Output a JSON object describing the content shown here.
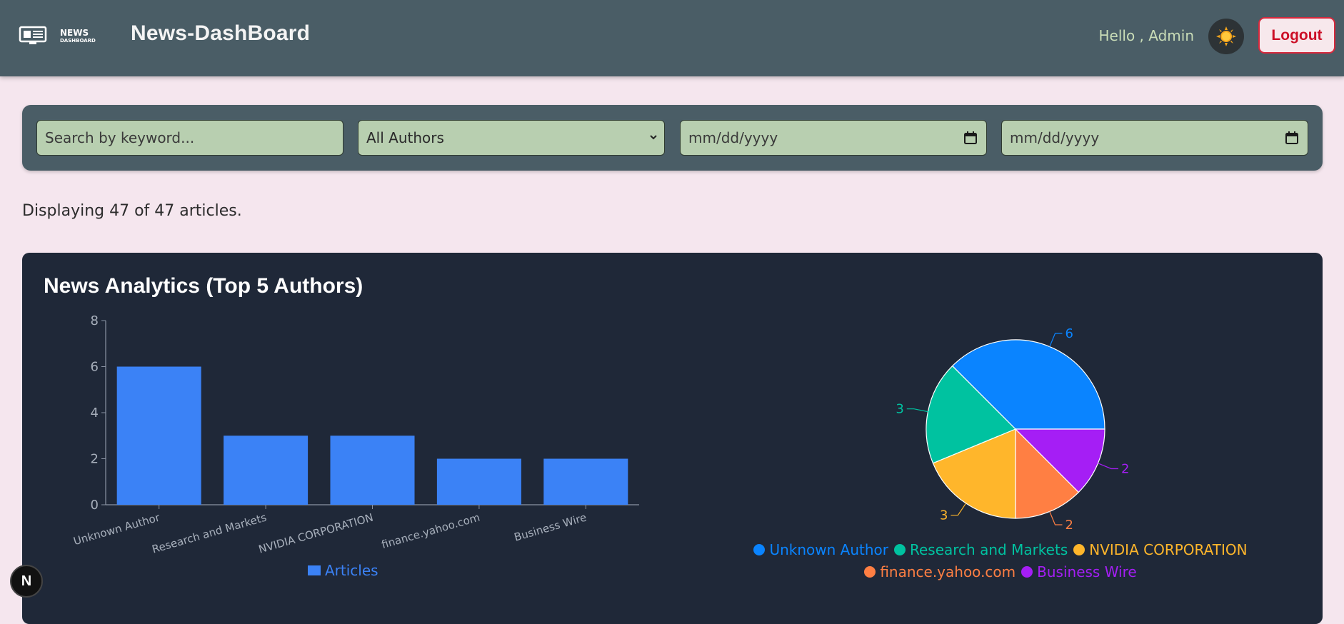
{
  "header": {
    "logo_text": "NEWS DASHBOARD",
    "title": "News-DashBoard",
    "greeting": "Hello , Admin",
    "logout_label": "Logout"
  },
  "filters": {
    "search_placeholder": "Search by keyword...",
    "author_selected": "All Authors",
    "date_from_placeholder": "mm/dd/yyyy",
    "date_to_placeholder": "mm/dd/yyyy"
  },
  "summary": {
    "count_text": "Displaying 47 of 47 articles."
  },
  "analytics": {
    "title": "News Analytics (Top 5 Authors)"
  },
  "chart_data": [
    {
      "type": "bar",
      "categories": [
        "Unknown Author",
        "Research and Markets",
        "NVIDIA CORPORATION",
        "finance.yahoo.com",
        "Business Wire"
      ],
      "series": [
        {
          "name": "Articles",
          "values": [
            6,
            3,
            3,
            2,
            2
          ]
        }
      ],
      "ylim": [
        0,
        8
      ],
      "yticks": [
        0,
        2,
        4,
        6,
        8
      ],
      "color": "#3b82f6",
      "legend": "bottom"
    },
    {
      "type": "pie",
      "labels": [
        "Unknown Author",
        "Research and Markets",
        "NVIDIA CORPORATION",
        "finance.yahoo.com",
        "Business Wire"
      ],
      "values": [
        6,
        3,
        3,
        2,
        2
      ],
      "colors": [
        "#0a84ff",
        "#00c2a0",
        "#ffb62b",
        "#ff7f43",
        "#a51ef5"
      ],
      "legend": "bottom"
    }
  ],
  "dev_badge": "N"
}
